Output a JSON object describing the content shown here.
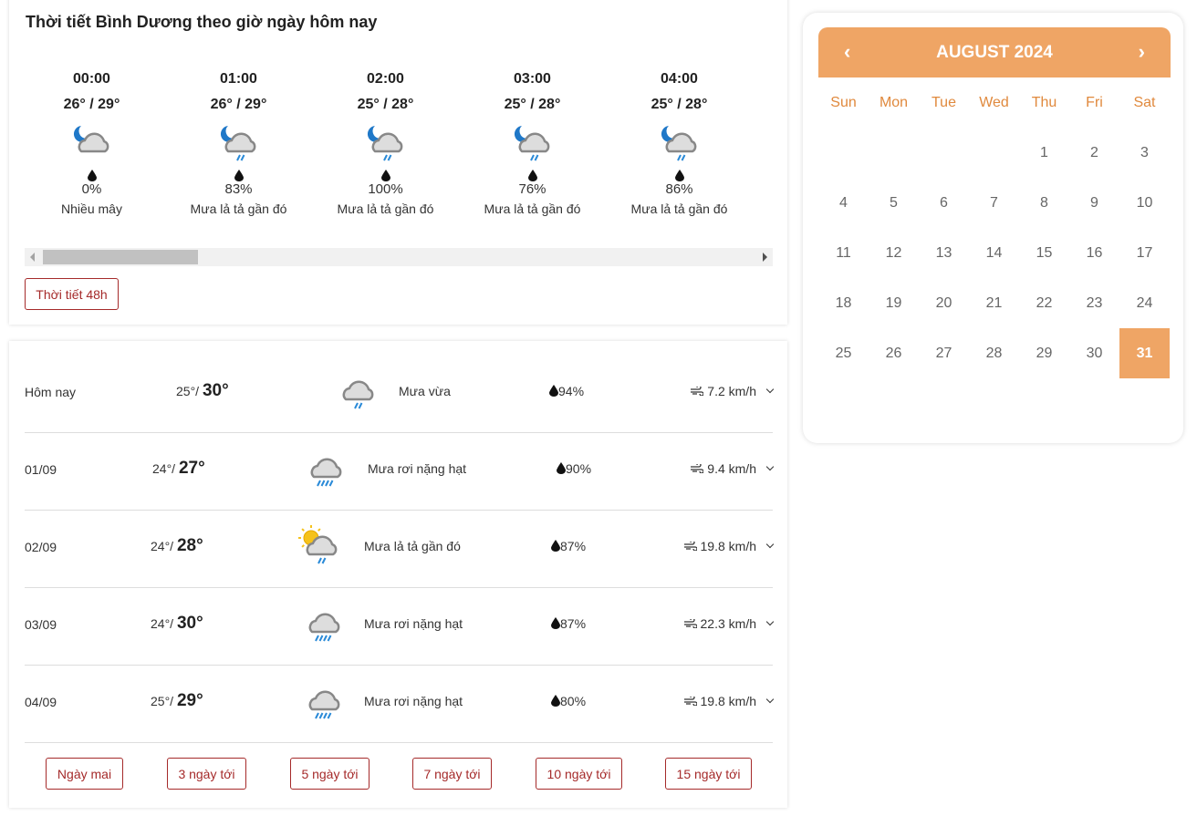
{
  "hourly": {
    "title": "Thời tiết Bình Dương theo giờ ngày hôm nay",
    "button": "Thời tiết 48h",
    "items": [
      {
        "time": "00:00",
        "temp": "26° / 29°",
        "icon": "moon-cloud-icon",
        "rain": "0%",
        "desc": "Nhiều mây"
      },
      {
        "time": "01:00",
        "temp": "26° / 29°",
        "icon": "moon-cloud-rain-icon",
        "rain": "83%",
        "desc": "Mưa lả tả gần đó"
      },
      {
        "time": "02:00",
        "temp": "25° / 28°",
        "icon": "moon-cloud-rain-icon",
        "rain": "100%",
        "desc": "Mưa lả tả gần đó"
      },
      {
        "time": "03:00",
        "temp": "25° / 28°",
        "icon": "moon-cloud-rain-icon",
        "rain": "76%",
        "desc": "Mưa lả tả gần đó"
      },
      {
        "time": "04:00",
        "temp": "25° / 28°",
        "icon": "moon-cloud-rain-icon",
        "rain": "86%",
        "desc": "Mưa lả tả gần đó"
      }
    ]
  },
  "daily": {
    "rows": [
      {
        "date": "Hôm nay",
        "low": "25°",
        "high": "30°",
        "icon": "cloud-rain-icon",
        "desc": "Mưa vừa",
        "rain": "94%",
        "wind": "7.2 km/h"
      },
      {
        "date": "01/09",
        "low": "24°",
        "high": "27°",
        "icon": "cloud-heavy-rain-icon",
        "desc": "Mưa rơi nặng hạt",
        "rain": "90%",
        "wind": "9.4 km/h"
      },
      {
        "date": "02/09",
        "low": "24°",
        "high": "28°",
        "icon": "sun-cloud-rain-icon",
        "desc": "Mưa lả tả gần đó",
        "rain": "87%",
        "wind": "19.8 km/h"
      },
      {
        "date": "03/09",
        "low": "24°",
        "high": "30°",
        "icon": "cloud-heavy-rain-icon",
        "desc": "Mưa rơi nặng hạt",
        "rain": "87%",
        "wind": "22.3 km/h"
      },
      {
        "date": "04/09",
        "low": "25°",
        "high": "29°",
        "icon": "cloud-heavy-rain-icon",
        "desc": "Mưa rơi nặng hạt",
        "rain": "80%",
        "wind": "19.8 km/h"
      }
    ],
    "buttons": [
      "Ngày mai",
      "3 ngày tới",
      "5 ngày tới",
      "7 ngày tới",
      "10 ngày tới",
      "15 ngày tới"
    ]
  },
  "calendar": {
    "title": "AUGUST 2024",
    "prev": "‹",
    "next": "›",
    "weekdays": [
      "Sun",
      "Mon",
      "Tue",
      "Wed",
      "Thu",
      "Fri",
      "Sat"
    ],
    "first_weekday": 4,
    "days": 31,
    "selected": 31,
    "accent": "#EFA565"
  }
}
